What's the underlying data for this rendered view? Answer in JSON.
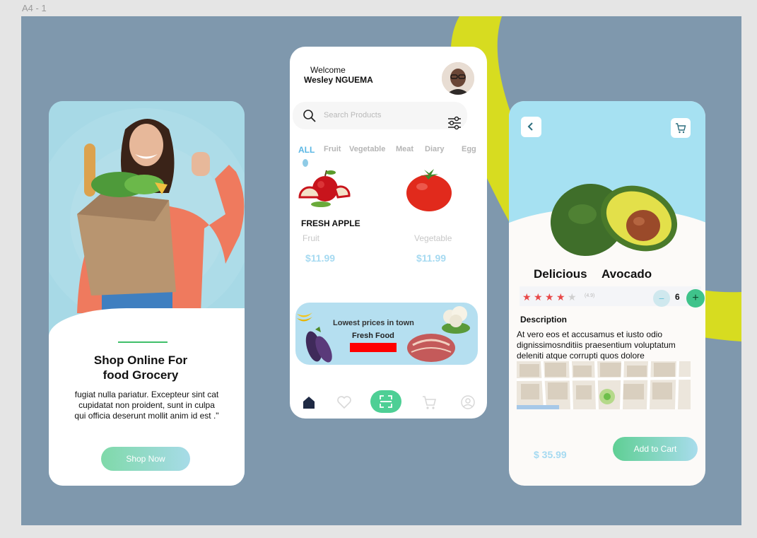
{
  "canvas": {
    "frame_label": "A4 - 1",
    "accent": "#d7dc20",
    "background": "#7f98ad"
  },
  "onboarding": {
    "title_line1": "Shop Online For",
    "title_line2": "food Grocery",
    "description": "fugiat nulla pariatur. Excepteur sint cat cupidatat non proident, sunt in culpa qui officia deserunt mollit anim id est .\"",
    "cta_label": "Shop Now"
  },
  "home": {
    "welcome": "Welcome",
    "user_name": "Wesley NGUEMA",
    "search_placeholder": "Search Products",
    "categories": [
      "ALL",
      "Fruit",
      "Vegetable",
      "Meat",
      "Diary",
      "Egg"
    ],
    "products": [
      {
        "name": "FRESH APPLE",
        "category": "Fruit",
        "price": "$11.99",
        "icon": "apple-icon"
      },
      {
        "name": "",
        "category": "Vegetable",
        "price": "$11.99",
        "icon": "tomato-icon"
      }
    ],
    "promo": {
      "title": "Lowest prices in town",
      "subtitle": "Fresh  Food"
    },
    "nav": [
      "home-icon",
      "heart-icon",
      "scan-icon",
      "cart-icon",
      "profile-icon"
    ]
  },
  "detail": {
    "name_word1": "Delicious",
    "name_word2": "Avocado",
    "rating": 4,
    "rating_text": "(4.9)",
    "quantity": "6",
    "minus_label": "−",
    "plus_label": "+",
    "description_title": "Description",
    "description": "At vero eos et accusamus et iusto odio dignissimosnditiis praesentium voluptatum deleniti atque corrupti quos dolore",
    "price": "$ 35.99",
    "cta_label": "Add to Cart"
  }
}
